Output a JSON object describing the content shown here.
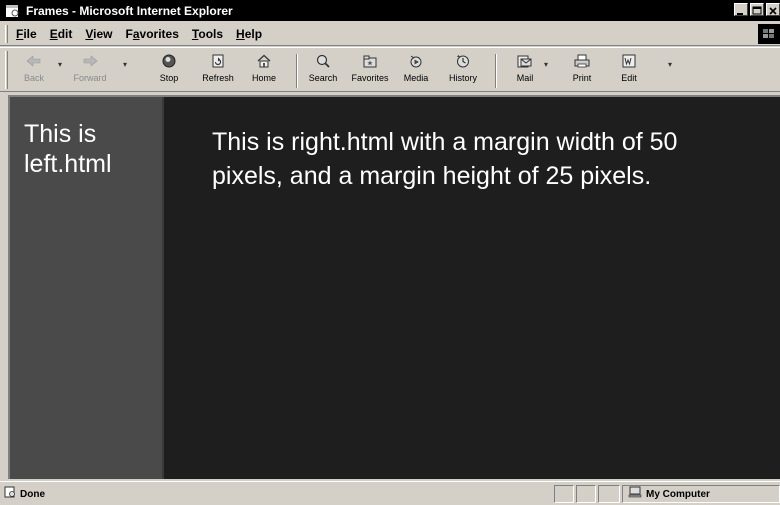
{
  "window": {
    "title": "Frames - Microsoft Internet Explorer"
  },
  "menu": {
    "items": [
      {
        "label": "File",
        "key": "F",
        "rest": "ile"
      },
      {
        "label": "Edit",
        "key": "E",
        "rest": "dit"
      },
      {
        "label": "View",
        "key": "V",
        "rest": "iew"
      },
      {
        "label": "Favorites",
        "pre": "F",
        "key": "a",
        "rest": "vorites"
      },
      {
        "label": "Tools",
        "key": "T",
        "rest": "ools"
      },
      {
        "label": "Help",
        "key": "H",
        "rest": "elp"
      }
    ]
  },
  "toolbar": {
    "back": "Back",
    "forward": "Forward",
    "stop": "Stop",
    "refresh": "Refresh",
    "home": "Home",
    "search": "Search",
    "favorites": "Favorites",
    "media": "Media",
    "history": "History",
    "mail": "Mail",
    "print": "Print",
    "edit": "Edit"
  },
  "frames": {
    "left_text": "This is left.html",
    "right_text": "This is right.html with a margin width of 50 pixels, and a margin height of 25 pixels."
  },
  "status": {
    "text": "Done",
    "zone": "My Computer"
  },
  "colors": {
    "left_frame_bg": "#4a4a4a",
    "right_frame_bg": "#1e1e1e",
    "chrome": "#d4d0c8"
  }
}
